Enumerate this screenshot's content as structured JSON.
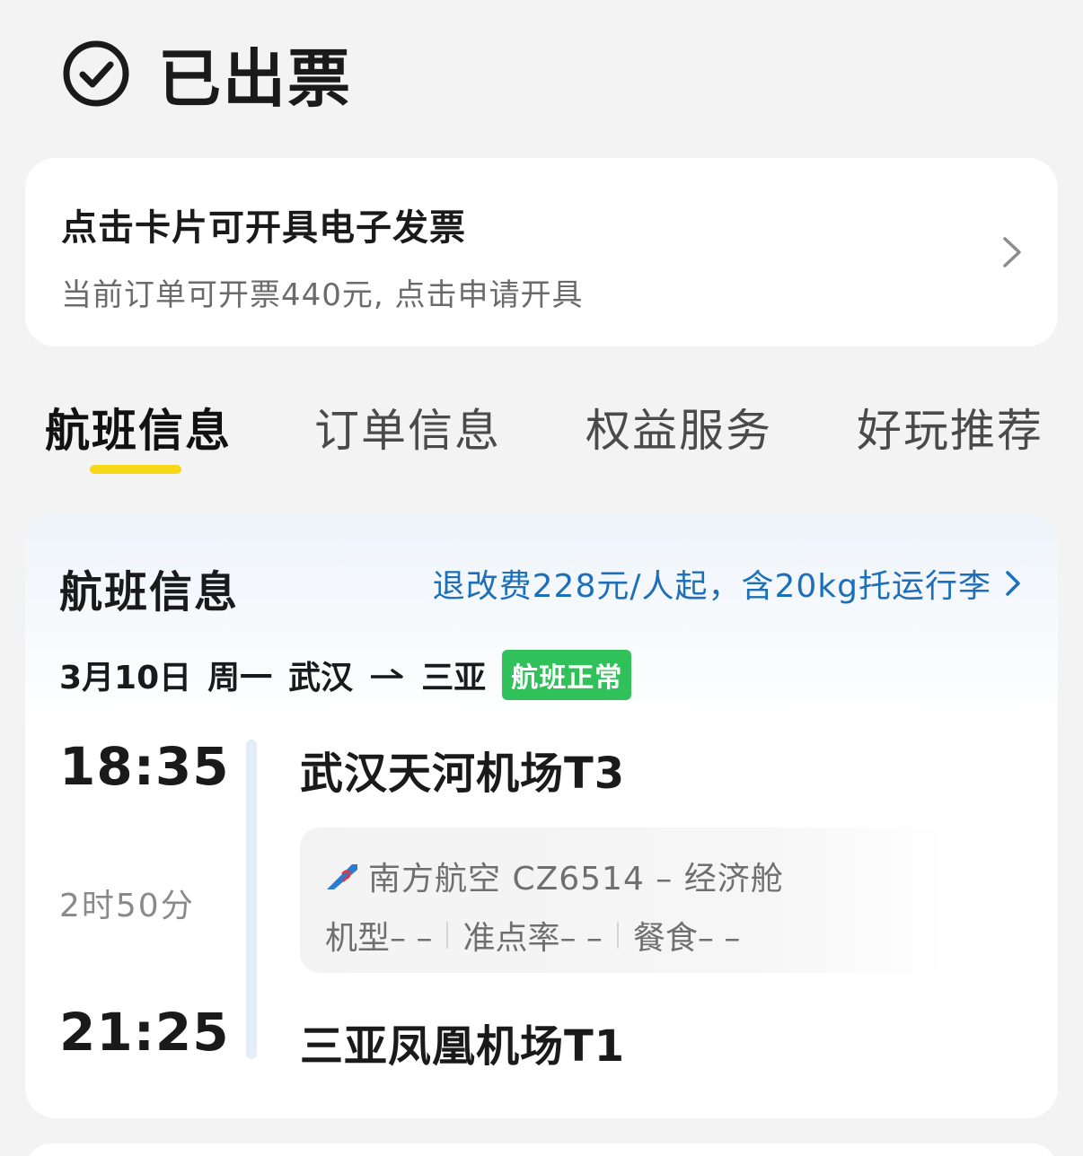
{
  "header": {
    "status_title": "已出票",
    "status_icon": "check-circle-icon"
  },
  "invoice": {
    "title": "点击卡片可开具电子发票",
    "subtitle": "当前订单可开票440元, 点击申请开具"
  },
  "tabs": [
    {
      "label": "航班信息",
      "active": true
    },
    {
      "label": "订单信息",
      "active": false
    },
    {
      "label": "权益服务",
      "active": false
    },
    {
      "label": "好玩推荐",
      "active": false
    }
  ],
  "flight": {
    "section_title": "航班信息",
    "refund_link": "退改费228元/人起，含20kg托运行李",
    "date": "3月10日",
    "weekday": "周一",
    "from_city": "武汉",
    "to_city": "三亚",
    "status_badge": "航班正常",
    "departure_time": "18:35",
    "arrival_time": "21:25",
    "duration": "2时50分",
    "departure_airport": "武汉天河机场T3",
    "arrival_airport": "三亚凤凰机场T1",
    "airline_line": "南方航空 CZ6514 – 经济舱",
    "aircraft": "机型– –",
    "on_time_rate": "准点率– –",
    "meal": "餐食– –"
  },
  "colors": {
    "accent_yellow": "#f6d816",
    "link_blue": "#1c6fb8",
    "status_green": "#31c15a",
    "timeline_blue": "#e3eef9"
  }
}
